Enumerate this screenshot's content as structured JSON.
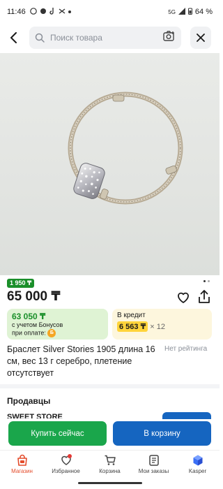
{
  "status_bar": {
    "time": "11:46",
    "network": "5G",
    "battery": "64 %"
  },
  "search": {
    "placeholder": "Поиск товара"
  },
  "product": {
    "old_price_badge": "1 950 ₸",
    "price": "65 000 ₸",
    "image_count": 2,
    "image_index": 1,
    "bonus": {
      "price": "63 050 ₸",
      "line1": "с учетом Бонусов",
      "line2": "при оплате:"
    },
    "credit": {
      "title": "В кредит",
      "monthly": "6 563 ₸",
      "term": "× 12"
    },
    "title": "Браслет Silver Stories 1905 длина 16 см, вес 13 г серебро, плетение отсутствует",
    "rating_text": "Нет рейтинга"
  },
  "sellers": {
    "title": "Продавцы",
    "first_seller_peek": "SWEET STORE"
  },
  "actions": {
    "buy_now": "Купить сейчас",
    "add_to_cart": "В корзину"
  },
  "bottom_nav": {
    "items": [
      {
        "label": "Магазин",
        "icon": "shop-icon",
        "active": true
      },
      {
        "label": "Избранное",
        "icon": "heart-icon",
        "active": false,
        "dot": true
      },
      {
        "label": "Корзина",
        "icon": "cart-icon",
        "active": false
      },
      {
        "label": "Мои заказы",
        "icon": "orders-icon",
        "active": false
      },
      {
        "label": "Kasper",
        "icon": "kasper-icon",
        "active": false
      }
    ]
  },
  "colors": {
    "green": "#1aa64b",
    "blue": "#1565c0",
    "accent_red": "#e44c2b",
    "credit_yellow": "#ffd43b"
  }
}
